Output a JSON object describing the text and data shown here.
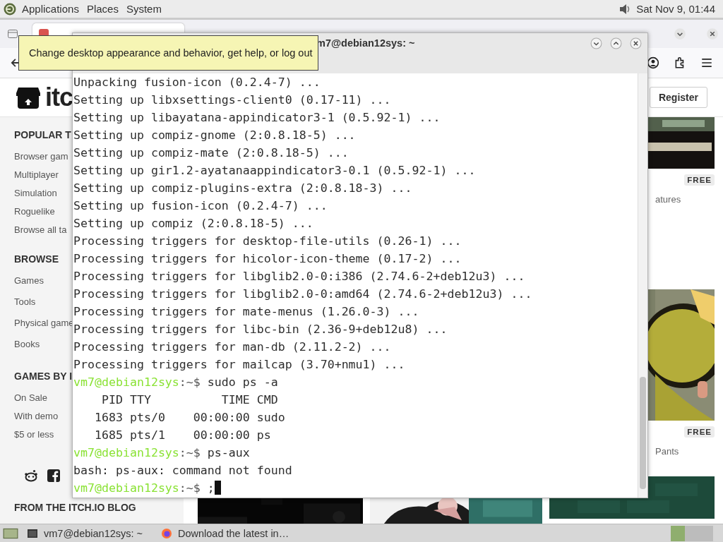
{
  "top_panel": {
    "menus": [
      {
        "label": "Applications"
      },
      {
        "label": "Places"
      },
      {
        "label": "System"
      }
    ],
    "clock": "Sat Nov 9, 01:44"
  },
  "browser": {
    "register": "Register",
    "logo_text": "itc",
    "sidebar": {
      "sections": [
        {
          "heading": "POPULAR T",
          "items": [
            "Browser gam",
            "Multiplayer",
            "Simulation",
            "Roguelike",
            "Browse all ta"
          ]
        },
        {
          "heading": "BROWSE",
          "items": [
            "Games",
            "Tools",
            "Physical game",
            "Books"
          ]
        },
        {
          "heading": "GAMES BY I",
          "items": [
            "On Sale",
            "With demo",
            "$5 or less"
          ]
        }
      ],
      "blog_heading": "FROM THE ITCH.IO BLOG"
    },
    "cards": [
      {
        "badge": "FREE",
        "caption": "atures"
      },
      {
        "badge": "FREE",
        "caption": "Pants"
      }
    ]
  },
  "terminal": {
    "title": "m7@debian12sys: ~",
    "lines": [
      {
        "kind": "output",
        "text": "Unpacking fusion-icon (0.2.4-7) ..."
      },
      {
        "kind": "output",
        "text": "Setting up libxsettings-client0 (0.17-11) ..."
      },
      {
        "kind": "output",
        "text": "Setting up libayatana-appindicator3-1 (0.5.92-1) ..."
      },
      {
        "kind": "output",
        "text": "Setting up compiz-gnome (2:0.8.18-5) ..."
      },
      {
        "kind": "output",
        "text": "Setting up compiz-mate (2:0.8.18-5) ..."
      },
      {
        "kind": "output",
        "text": "Setting up gir1.2-ayatanaappindicator3-0.1 (0.5.92-1) ..."
      },
      {
        "kind": "output",
        "text": "Setting up compiz-plugins-extra (2:0.8.18-3) ..."
      },
      {
        "kind": "output",
        "text": "Setting up fusion-icon (0.2.4-7) ..."
      },
      {
        "kind": "output",
        "text": "Setting up compiz (2:0.8.18-5) ..."
      },
      {
        "kind": "output",
        "text": "Processing triggers for desktop-file-utils (0.26-1) ..."
      },
      {
        "kind": "output",
        "text": "Processing triggers for hicolor-icon-theme (0.17-2) ..."
      },
      {
        "kind": "output",
        "text": "Processing triggers for libglib2.0-0:i386 (2.74.6-2+deb12u3) ..."
      },
      {
        "kind": "output",
        "text": "Processing triggers for libglib2.0-0:amd64 (2.74.6-2+deb12u3) ..."
      },
      {
        "kind": "output",
        "text": "Processing triggers for mate-menus (1.26.0-3) ..."
      },
      {
        "kind": "output",
        "text": "Processing triggers for libc-bin (2.36-9+deb12u8) ..."
      },
      {
        "kind": "output",
        "text": "Processing triggers for man-db (2.11.2-2) ..."
      },
      {
        "kind": "output",
        "text": "Processing triggers for mailcap (3.70+nmu1) ..."
      },
      {
        "kind": "prompt",
        "host": "vm7@debian12sys",
        "rest": ":~$ ",
        "command": "sudo ps -a",
        "cursor": false
      },
      {
        "kind": "output",
        "text": "    PID TTY          TIME CMD"
      },
      {
        "kind": "output",
        "text": "   1683 pts/0    00:00:00 sudo"
      },
      {
        "kind": "output",
        "text": "   1685 pts/1    00:00:00 ps"
      },
      {
        "kind": "prompt",
        "host": "vm7@debian12sys",
        "rest": ":~$ ",
        "command": "ps-aux",
        "cursor": false
      },
      {
        "kind": "output",
        "text": "bash: ps-aux: command not found"
      },
      {
        "kind": "prompt",
        "host": "vm7@debian12sys",
        "rest": ":~$ ",
        "command": ";",
        "cursor": true
      }
    ]
  },
  "tooltip": {
    "text": "Change desktop appearance and behavior, get help, or log out"
  },
  "taskbar": {
    "tasks": [
      {
        "kind": "terminal",
        "label": "vm7@debian12sys: ~"
      },
      {
        "kind": "browser",
        "label": "Download the latest in…"
      }
    ]
  }
}
